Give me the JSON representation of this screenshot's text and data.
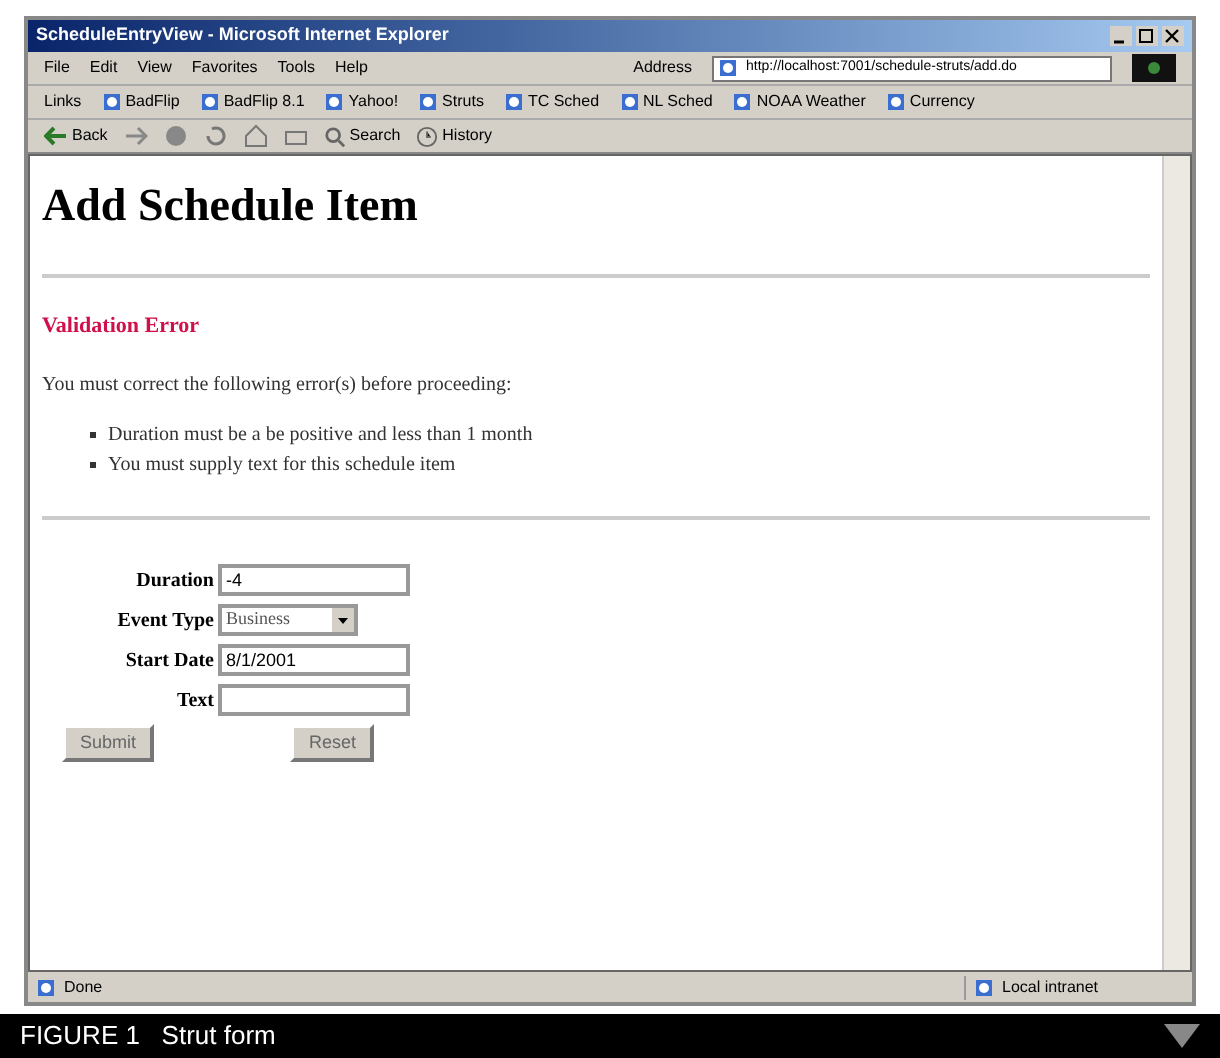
{
  "window": {
    "title": "ScheduleEntryView - Microsoft Internet Explorer"
  },
  "menu": [
    "File",
    "Edit",
    "View",
    "Favorites",
    "Tools",
    "Help"
  ],
  "address": {
    "label": "Address",
    "value": "http://localhost:7001/schedule-struts/add.do"
  },
  "links": {
    "label": "Links",
    "items": [
      "BadFlip",
      "BadFlip 8.1",
      "Yahoo!",
      "Struts",
      "TC Sched",
      "NL Sched",
      "NOAA Weather",
      "Currency"
    ]
  },
  "toolbar": [
    {
      "kind": "back",
      "label": "Back"
    },
    {
      "kind": "forward"
    },
    {
      "kind": "stop"
    },
    {
      "kind": "refresh"
    },
    {
      "kind": "home"
    },
    {
      "kind": "print"
    },
    {
      "kind": "search",
      "label": "Search"
    },
    {
      "kind": "history",
      "label": "History"
    }
  ],
  "page": {
    "heading": "Add Schedule Item",
    "error_title": "Validation Error",
    "error_intro": "You must correct the following error(s) before proceeding:",
    "errors": [
      "Duration must be a be positive and less than 1 month",
      "You must supply text for this schedule item"
    ],
    "fields": [
      {
        "kind": "text",
        "label": "Duration",
        "value": "-4"
      },
      {
        "kind": "select",
        "label": "Event Type",
        "value": "Business"
      },
      {
        "kind": "text",
        "label": "Start Date",
        "value": "8/1/2001"
      },
      {
        "kind": "text",
        "label": "Text"
      }
    ],
    "buttons": [
      "Submit",
      "Reset"
    ]
  },
  "status_bar": {
    "text": "Done",
    "zone": "Local intranet"
  },
  "caption": "FIGURE 1   Strut form"
}
